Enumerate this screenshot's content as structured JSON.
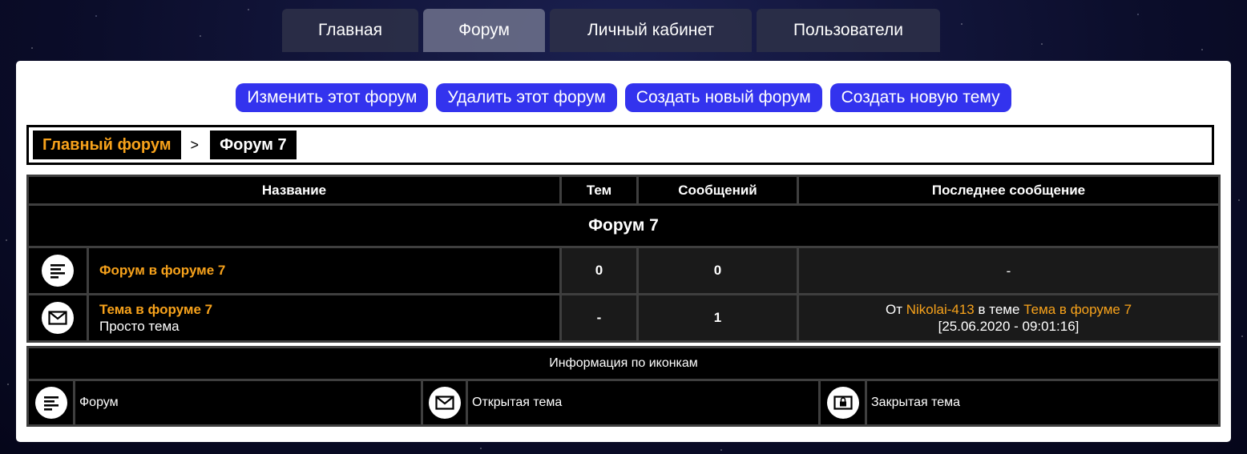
{
  "nav": {
    "tabs": [
      {
        "label": "Главная"
      },
      {
        "label": "Форум"
      },
      {
        "label": "Личный кабинет"
      },
      {
        "label": "Пользователи"
      }
    ]
  },
  "actions": {
    "edit_forum": "Изменить этот форум",
    "delete_forum": "Удалить этот форум",
    "create_forum": "Создать новый форум",
    "create_topic": "Создать новую тему"
  },
  "breadcrumb": {
    "root": "Главный форум",
    "separator": ">",
    "current": "Форум 7"
  },
  "table": {
    "headers": {
      "name": "Название",
      "topics": "Тем",
      "messages": "Сообщений",
      "last": "Последнее сообщение"
    },
    "section_title": "Форум 7",
    "rows": [
      {
        "icon": "forum-icon",
        "title": "Форум в форуме 7",
        "topics": "0",
        "messages": "0",
        "last": "-"
      },
      {
        "icon": "open-topic-icon",
        "title": "Тема в форуме 7",
        "description": "Просто тема",
        "topics": "-",
        "messages": "1",
        "last_from_prefix": "От",
        "last_author": "Nikolai-413",
        "last_in_topic_prefix": "в теме",
        "last_topic": "Тема в форуме 7",
        "last_date": "[25.06.2020 - 09:01:16]"
      }
    ]
  },
  "legend": {
    "title": "Информация по иконкам",
    "items": [
      {
        "icon": "forum-icon",
        "label": "Форум"
      },
      {
        "icon": "open-topic-icon",
        "label": "Открытая тема"
      },
      {
        "icon": "closed-topic-icon",
        "label": "Закрытая тема"
      }
    ]
  },
  "colors": {
    "accent_orange": "#f7a21b",
    "button_blue": "#3333ee",
    "table_bg": "#000000"
  }
}
